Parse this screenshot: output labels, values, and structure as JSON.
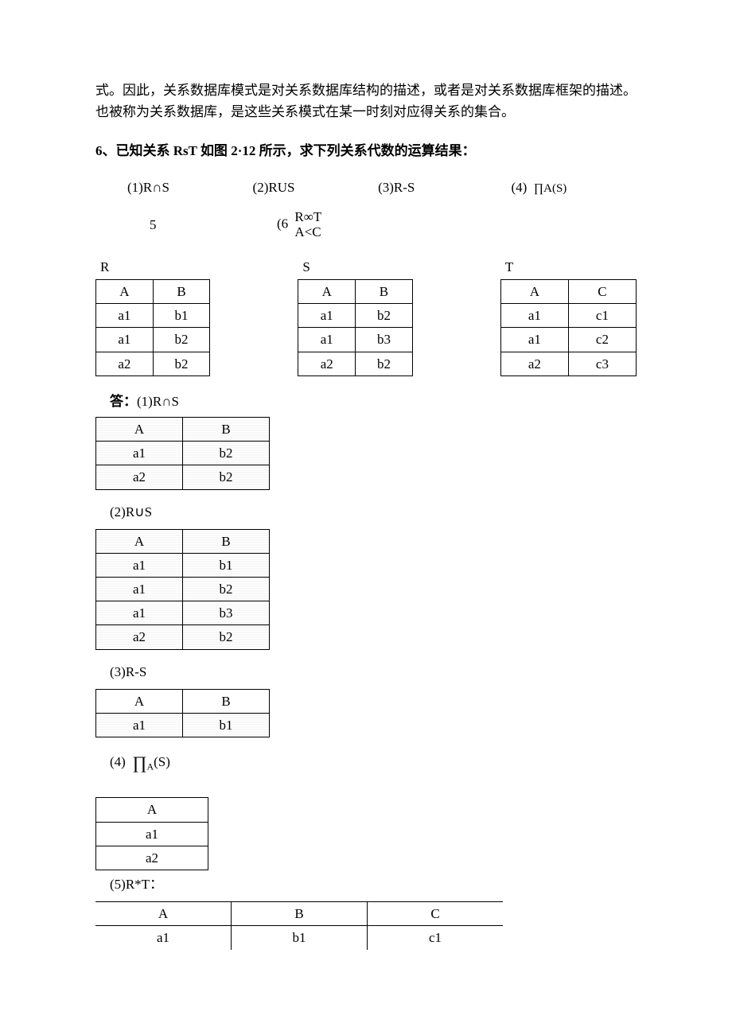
{
  "intro_para": "式。因此，关系数据库模式是对关系数据库结构的描述，或者是对关系数据库框架的描述。也被称为关系数据库，是这些关系模式在某一时刻对应得关系的集合。",
  "question_prefix": "6、",
  "question_body_1": "已知关系 ",
  "question_rst": "RsT ",
  "question_body_2": "如图 ",
  "question_fig": "2·12 ",
  "question_body_3": "所示，求下列关系代数的运算结果：",
  "exprs": {
    "e1": "(1)R∩S",
    "e2": "(2)RUS",
    "e3": "(3)R-S",
    "e4_a": "(4)",
    "e4_b": "∏A(S)",
    "e5": "5",
    "e6": "(6",
    "e6_top": "R∞T",
    "e6_bot": "A<C"
  },
  "tableR": {
    "label": "R",
    "head": [
      "A",
      "B"
    ],
    "rows": [
      [
        "a1",
        "b1"
      ],
      [
        "a1",
        "b2"
      ],
      [
        "a2",
        "b2"
      ]
    ]
  },
  "tableS": {
    "label": "S",
    "head": [
      "A",
      "B"
    ],
    "rows": [
      [
        "a1",
        "b2"
      ],
      [
        "a1",
        "b3"
      ],
      [
        "a2",
        "b2"
      ]
    ]
  },
  "tableT": {
    "label": "T",
    "head": [
      "A",
      "C"
    ],
    "rows": [
      [
        "a1",
        "c1"
      ],
      [
        "a1",
        "c2"
      ],
      [
        "a2",
        "c3"
      ]
    ]
  },
  "answer_label": "答：",
  "ans1_label": "(1)R∩S",
  "ans1": {
    "head": [
      "A",
      "B"
    ],
    "rows": [
      [
        "a1",
        "b2"
      ],
      [
        "a2",
        "b2"
      ]
    ]
  },
  "ans2_label": "(2)R∪S",
  "ans2": {
    "head": [
      "A",
      "B"
    ],
    "rows": [
      [
        "a1",
        "b1"
      ],
      [
        "a1",
        "b2"
      ],
      [
        "a1",
        "b3"
      ],
      [
        "a2",
        "b2"
      ]
    ]
  },
  "ans3_label": "(3)R-S",
  "ans3": {
    "head": [
      "A",
      "B"
    ],
    "rows": [
      [
        "a1",
        "b1"
      ]
    ]
  },
  "ans4_label_a": "(4)",
  "ans4_label_pi": "∏",
  "ans4_label_sub": "A",
  "ans4_label_b": "(S)",
  "ans4": {
    "head": [
      "A"
    ],
    "rows": [
      [
        "a1"
      ],
      [
        "a2"
      ]
    ]
  },
  "ans5_label": "(5)R*T：",
  "ans5": {
    "head": [
      "A",
      "B",
      "C"
    ],
    "rows": [
      [
        "a1",
        "b1",
        "c1"
      ]
    ]
  }
}
